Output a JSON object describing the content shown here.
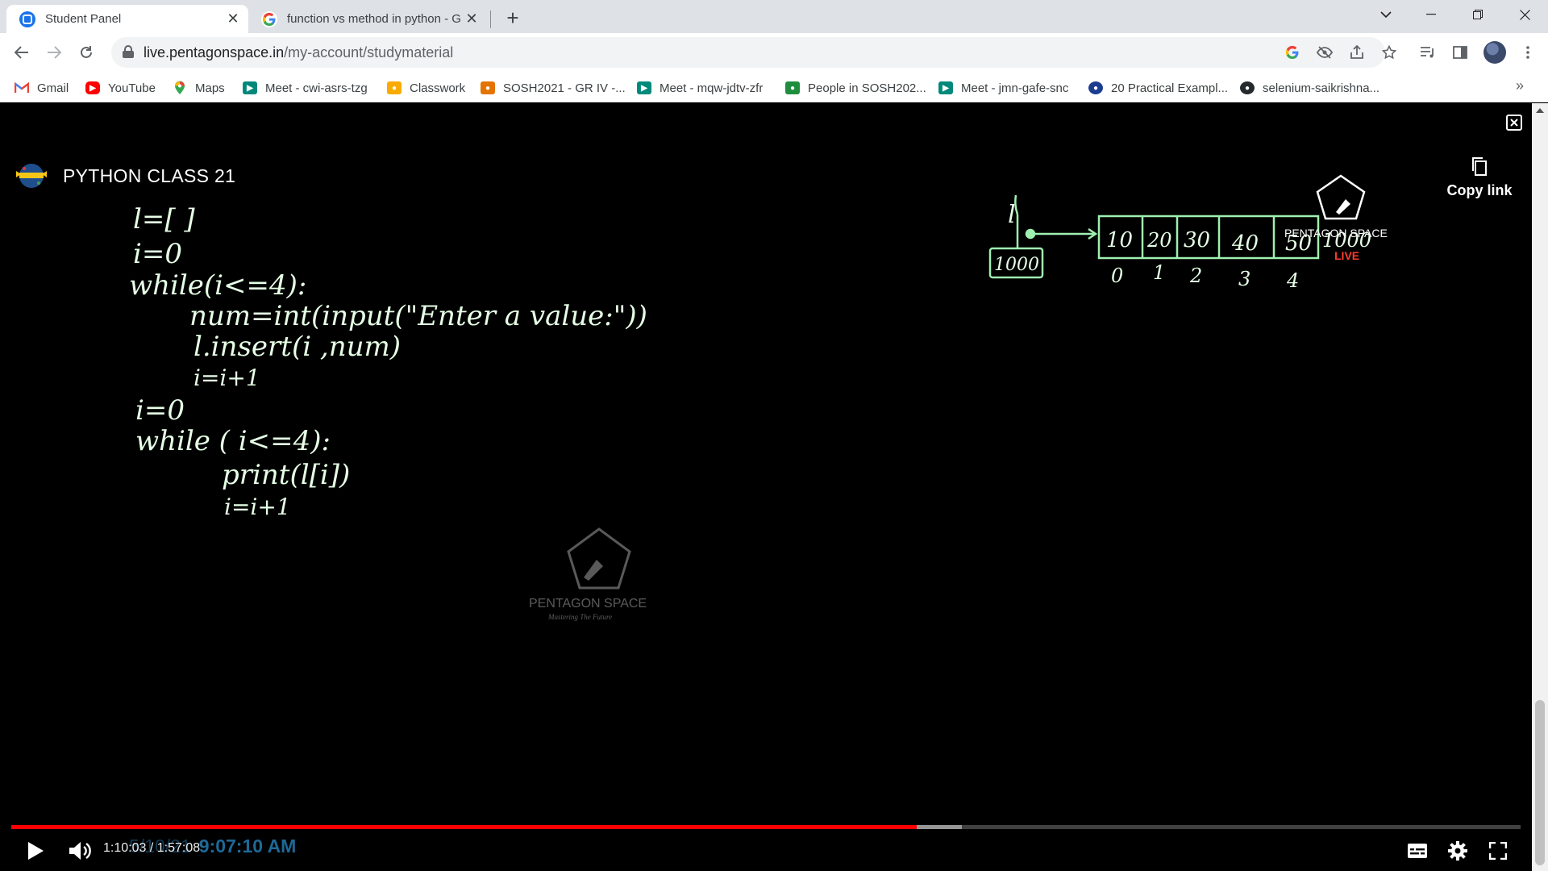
{
  "browser": {
    "tabs": [
      {
        "title": "Student Panel",
        "active": true,
        "icon": "student-panel-favicon"
      },
      {
        "title": "function vs method in python - G",
        "active": false,
        "icon": "google-favicon"
      }
    ],
    "new_tab_label": "+",
    "url_host": "live.pentagonspace.in",
    "url_path": "/my-account/studymaterial"
  },
  "bookmarks": [
    {
      "label": "Gmail",
      "icon": "gmail-icon",
      "color": "#ea4335"
    },
    {
      "label": "YouTube",
      "icon": "youtube-icon",
      "color": "#ff0000"
    },
    {
      "label": "Maps",
      "icon": "maps-icon",
      "color": "#34a853"
    },
    {
      "label": "Meet - cwi-asrs-tzg",
      "icon": "meet-icon",
      "color": "#00897b"
    },
    {
      "label": "Classwork",
      "icon": "classroom-icon",
      "color": "#f9ab00"
    },
    {
      "label": "SOSH2021 - GR IV -...",
      "icon": "classroom-icon",
      "color": "#e37400"
    },
    {
      "label": "Meet - mqw-jdtv-zfr",
      "icon": "meet-icon",
      "color": "#00897b"
    },
    {
      "label": "People in SOSH202...",
      "icon": "classroom-icon",
      "color": "#1e8e3e"
    },
    {
      "label": "Meet - jmn-gafe-snc",
      "icon": "meet-icon",
      "color": "#00897b"
    },
    {
      "label": "20 Practical Exampl...",
      "icon": "site-icon",
      "color": "#1a3d8f"
    },
    {
      "label": "selenium-saikrishna...",
      "icon": "github-icon",
      "color": "#24292e"
    }
  ],
  "video": {
    "title": "PYTHON CLASS 21",
    "copy_link_label": "Copy link",
    "current_time": "1:10:03",
    "duration": "1:57:08",
    "time_separator": " / ",
    "overlay_date": "5/10/21",
    "overlay_clock": "9:07:10 AM",
    "progress_played": 0.6,
    "progress_loaded": 0.63,
    "accent_color": "#ff0000"
  },
  "board": {
    "code_lines": [
      "l=[ ]",
      "i=0",
      "while(i<=4):",
      "num=int(input(\"Enter a value:\"))",
      "l.insert(i ,num)",
      "i=i+1",
      "i=0",
      "while ( i<=4):",
      "print(l[i])",
      "i=i+1"
    ],
    "diagram": {
      "variable": "l",
      "address": "1000",
      "values": [
        "10",
        "20",
        "30",
        "40",
        "50"
      ],
      "indices": [
        "0",
        "1",
        "2",
        "3",
        "4"
      ],
      "trailing_address": "1000"
    },
    "watermark_center": "PENTAGON SPACE",
    "watermark_center_tagline": "Mastering The Future",
    "watermark_corner": "PENTAGON SPACE",
    "watermark_corner_tagline": "LIVE",
    "chalk_color": "#e6ffe6",
    "diagram_color": "#9ff0b0"
  }
}
